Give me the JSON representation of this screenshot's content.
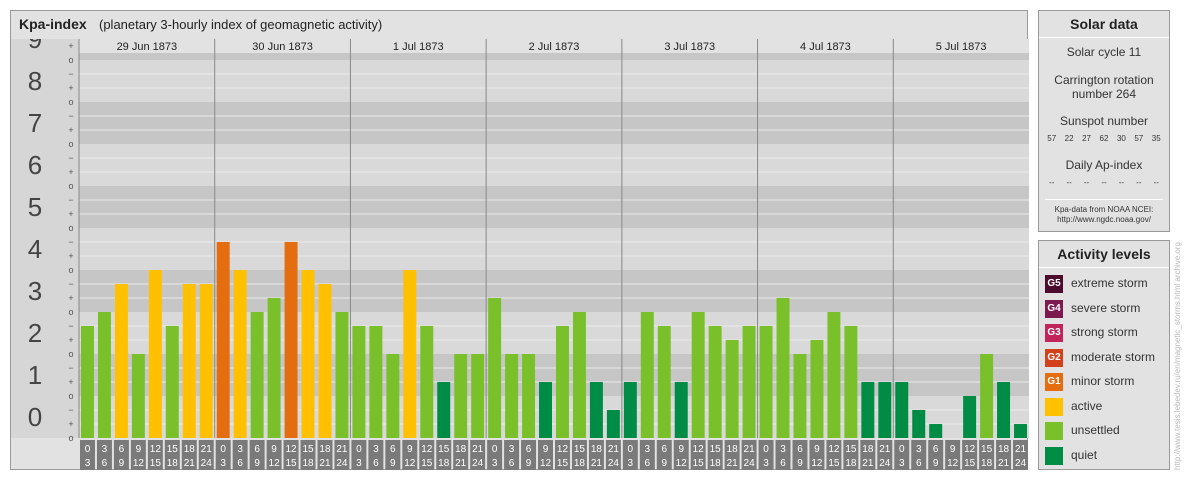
{
  "title": {
    "main": "Kpa-index",
    "sub": "(planetary 3-hourly index of geomagnetic activity)"
  },
  "chart_data": {
    "type": "bar",
    "ylim": [
      0,
      9
    ],
    "y_ticks": [
      "0",
      "1",
      "2",
      "3",
      "4",
      "5",
      "6",
      "7",
      "8",
      "9"
    ],
    "thirds_markers": [
      "−",
      "o",
      "+"
    ],
    "day_labels": [
      "29 Jun 1873",
      "30 Jun 1873",
      "1 Jul 1873",
      "2 Jul 1873",
      "3 Jul 1873",
      "4 Jul 1873",
      "5 Jul 1873"
    ],
    "hour_start": [
      "0",
      "3",
      "6",
      "9",
      "12",
      "15",
      "18",
      "21"
    ],
    "hour_end": [
      "3",
      "6",
      "9",
      "12",
      "15",
      "18",
      "21",
      "24"
    ],
    "values": [
      2.667,
      3.0,
      3.667,
      2.0,
      4.0,
      2.667,
      3.667,
      3.667,
      4.667,
      4.0,
      3.0,
      3.333,
      4.667,
      4.0,
      3.667,
      3.0,
      2.667,
      2.667,
      2.0,
      4.0,
      2.667,
      1.333,
      2.0,
      2.0,
      3.333,
      2.0,
      2.0,
      1.333,
      2.667,
      3.0,
      1.333,
      0.667,
      1.333,
      3.0,
      2.667,
      1.333,
      3.0,
      2.667,
      2.333,
      2.667,
      2.667,
      3.333,
      2.0,
      2.333,
      3.0,
      2.667,
      1.333,
      1.333,
      1.333,
      0.667,
      0.333,
      0.0,
      1.0,
      2.0,
      1.333,
      0.333
    ],
    "colors": {
      "quiet": "#008c45",
      "unsettled": "#7ac02a",
      "active": "#ffc000",
      "minor": "#e46d10",
      "moderate": "#d2401c",
      "strong": "#c0245a",
      "severe": "#7c1a50",
      "extreme": "#4c0a2c"
    }
  },
  "solar": {
    "heading": "Solar data",
    "cycle": "Solar cycle 11",
    "carrington_1": "Carrington rotation",
    "carrington_2": "number 264",
    "sunspot_heading": "Sunspot number",
    "sunspots": [
      "57",
      "22",
      "27",
      "62",
      "30",
      "57",
      "35"
    ],
    "ap_heading": "Daily Ap-index",
    "ap_values": [
      "--",
      "--",
      "--",
      "--",
      "--",
      "--",
      "--"
    ],
    "source_1": "Kpa-data from NOAA NCEI:",
    "source_2": "http://www.ngdc.noaa.gov/"
  },
  "activity": {
    "heading": "Activity levels",
    "items": [
      {
        "code": "G5",
        "label": "extreme storm",
        "color": "#4c0a2c"
      },
      {
        "code": "G4",
        "label": "severe storm",
        "color": "#7c1a50"
      },
      {
        "code": "G3",
        "label": "strong storm",
        "color": "#c0245a"
      },
      {
        "code": "G2",
        "label": "moderate storm",
        "color": "#d2401c"
      },
      {
        "code": "G1",
        "label": "minor storm",
        "color": "#e46d10"
      },
      {
        "code": "",
        "label": "active",
        "color": "#ffc000"
      },
      {
        "code": "",
        "label": "unsettled",
        "color": "#7ac02a"
      },
      {
        "code": "",
        "label": "quiet",
        "color": "#008c45"
      }
    ]
  },
  "credit": "http://www.tesis.lebedev.ru/en/magnetic_storms.html  archive.org"
}
